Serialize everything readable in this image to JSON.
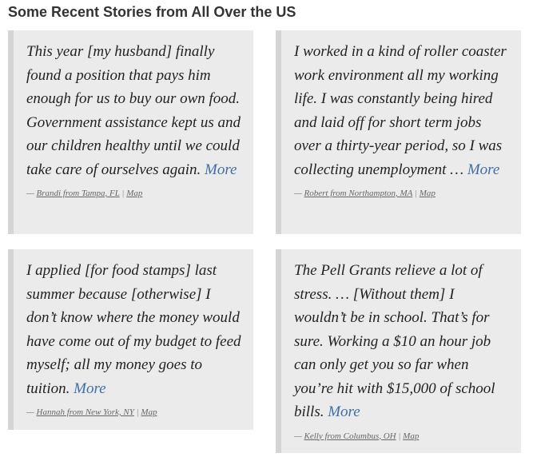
{
  "heading": "Some Recent Stories from All Over the US",
  "stories": [
    {
      "quote": "This year [my husband] finally found a position that pays him enough for us to buy our own food. Government assistance kept us and our children healthy until we could take care of ourselves again.",
      "more": "More",
      "dash": "—",
      "author": "Brandi from Tampa, FL",
      "sep": "|",
      "map": "Map"
    },
    {
      "quote": "I worked in a kind of roller coaster work environment all my working life. I was constantly being hired and laid off for short term jobs over a thirty-year period, so I was collecting unemployment …",
      "more": "More",
      "dash": "—",
      "author": "Robert from Northampton, MA",
      "sep": "|",
      "map": "Map"
    },
    {
      "quote": "I applied [for food stamps] last summer because [otherwise] I don’t know where the money would have come out of my budget to feed myself; all my money goes to tuition.",
      "more": "More",
      "dash": "—",
      "author": "Hannah from New York, NY",
      "sep": "|",
      "map": "Map"
    },
    {
      "quote": "The Pell Grants relieve a lot of stress. … [Without them] I wouldn’t be in school. That’s for sure. Working a $10 an hour job can only get you so far when you’re hit with $15,000 of school bills.",
      "more": "More",
      "dash": "—",
      "author": "Kelly from Columbus, OH",
      "sep": "|",
      "map": "Map"
    }
  ]
}
